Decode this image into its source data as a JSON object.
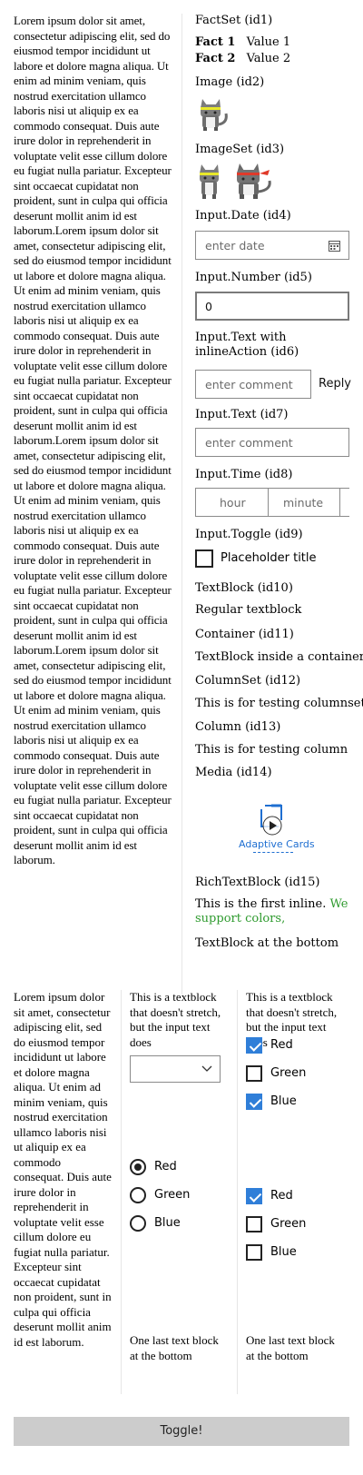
{
  "left_text": "Lorem ipsum dolor sit amet, consectetur adipiscing elit, sed do eiusmod tempor incididunt ut labore et dolore magna aliqua. Ut enim ad minim veniam, quis nostrud exercitation ullamco laboris nisi ut aliquip ex ea commodo consequat. Duis aute irure dolor in reprehenderit in voluptate velit esse cillum dolore eu fugiat nulla pariatur. Excepteur sint occaecat cupidatat non proident, sunt in culpa qui officia deserunt mollit anim id est laborum.Lorem ipsum dolor sit amet, consectetur adipiscing elit, sed do eiusmod tempor incididunt ut labore et dolore magna aliqua. Ut enim ad minim veniam, quis nostrud exercitation ullamco laboris nisi ut aliquip ex ea commodo consequat. Duis aute irure dolor in reprehenderit in voluptate velit esse cillum dolore eu fugiat nulla pariatur. Excepteur sint occaecat cupidatat non proident, sunt in culpa qui officia deserunt mollit anim id est laborum.Lorem ipsum dolor sit amet, consectetur adipiscing elit, sed do eiusmod tempor incididunt ut labore et dolore magna aliqua. Ut enim ad minim veniam, quis nostrud exercitation ullamco laboris nisi ut aliquip ex ea commodo consequat. Duis aute irure dolor in reprehenderit in voluptate velit esse cillum dolore eu fugiat nulla pariatur. Excepteur sint occaecat cupidatat non proident, sunt in culpa qui officia deserunt mollit anim id est laborum.Lorem ipsum dolor sit amet, consectetur adipiscing elit, sed do eiusmod tempor incididunt ut labore et dolore magna aliqua. Ut enim ad minim veniam, quis nostrud exercitation ullamco laboris nisi ut aliquip ex ea commodo consequat. Duis aute irure dolor in reprehenderit in voluptate velit esse cillum dolore eu fugiat nulla pariatur. Excepteur sint occaecat cupidatat non proident, sunt in culpa qui officia deserunt mollit anim id est laborum.",
  "factset": {
    "label": "FactSet (id1)",
    "facts": [
      {
        "title": "Fact 1",
        "value": "Value 1"
      },
      {
        "title": "Fact 2",
        "value": "Value 2"
      }
    ]
  },
  "image": {
    "label": "Image (id2)"
  },
  "imageset": {
    "label": "ImageSet (id3)"
  },
  "input_date": {
    "label": "Input.Date (id4)",
    "placeholder": "enter date"
  },
  "input_number": {
    "label": "Input.Number (id5)",
    "value": "0"
  },
  "input_text_inline": {
    "label": "Input.Text with inlineAction (id6)",
    "placeholder": "enter comment",
    "action": "Reply"
  },
  "input_text": {
    "label": "Input.Text (id7)",
    "placeholder": "enter comment"
  },
  "input_time": {
    "label": "Input.Time (id8)",
    "hour": "hour",
    "minute": "minute"
  },
  "input_toggle": {
    "label": "Input.Toggle (id9)",
    "title": "Placeholder title",
    "checked": false
  },
  "textblock": {
    "label": "TextBlock (id10)",
    "text": "Regular textblock"
  },
  "container": {
    "label": "Container (id11)",
    "text": "TextBlock inside a container"
  },
  "columnset": {
    "label": "ColumnSet (id12)",
    "text": "This is for testing columnset"
  },
  "column": {
    "label": "Column (id13)",
    "text": "This is for testing column"
  },
  "media": {
    "label": "Media (id14)",
    "poster_text": "Adaptive Cards"
  },
  "richtext": {
    "label": "RichTextBlock (id15)",
    "inline1": "This is the first inline.",
    "inline2": "We support colors,",
    "inline2_color": "#2e9a2e"
  },
  "textblock_bottom": "TextBlock at the bottom",
  "bottom": {
    "col1_text": "Lorem ipsum dolor sit amet, consectetur adipiscing elit, sed do eiusmod tempor incididunt ut labore et dolore magna aliqua. Ut enim ad minim veniam, quis nostrud exercitation ullamco laboris nisi ut aliquip ex ea commodo consequat. Duis aute irure dolor in reprehenderit in voluptate velit esse cillum dolore eu fugiat nulla pariatur. Excepteur sint occaecat cupidatat non proident, sunt in culpa qui officia deserunt mollit anim id est laborum.",
    "col2_header": "This is a textblock that doesn't stretch, but the input text does",
    "col3_header": "This is a textblock that doesn't stretch, but the input text does",
    "colors": [
      "Red",
      "Green",
      "Blue"
    ],
    "col3_checks_top": [
      true,
      false,
      true
    ],
    "col2_radio_selected": 0,
    "col3_checks_bottom": [
      true,
      false,
      false
    ],
    "last_text": "One last text block at the bottom"
  },
  "toggle_button": "Toggle!",
  "accent_color": "#2f7ed8"
}
